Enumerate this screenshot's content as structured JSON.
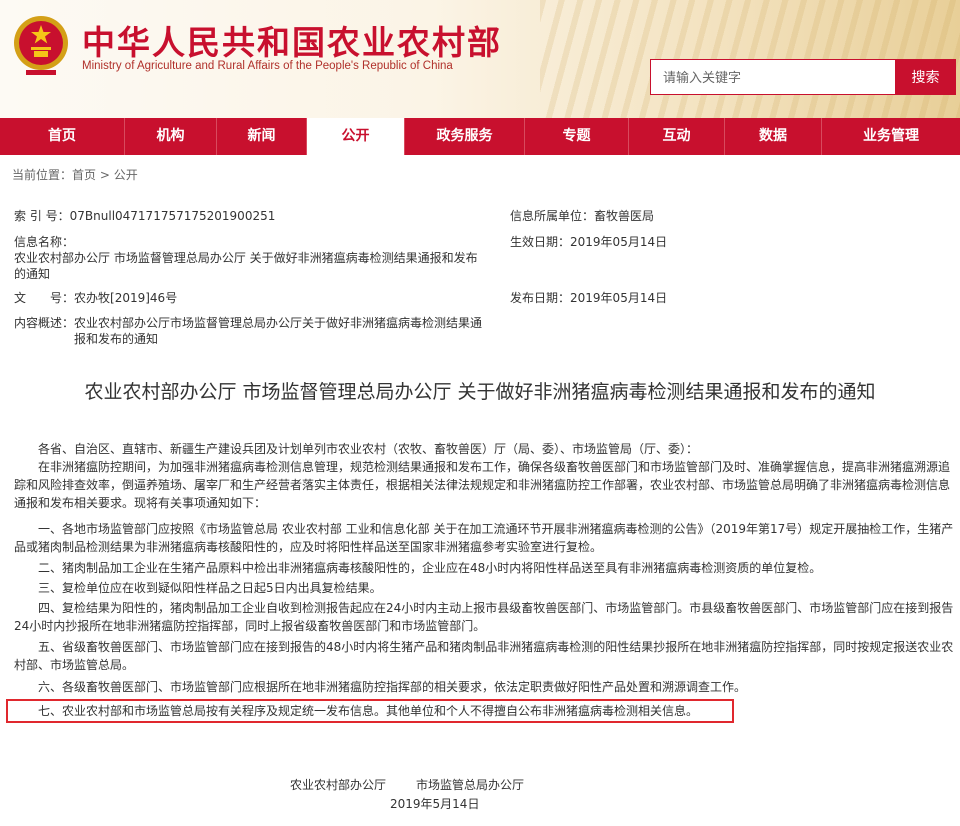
{
  "header": {
    "title": "中华人民共和国农业农村部",
    "subtitle": "Ministry of Agriculture and Rural Affairs of the People's Republic of China",
    "search_placeholder": "请输入关键字",
    "search_button": "搜索",
    "brand_color": "#c8102e"
  },
  "nav": {
    "items": [
      {
        "label": "首页"
      },
      {
        "label": "机构"
      },
      {
        "label": "新闻"
      },
      {
        "label": "公开",
        "active": true
      },
      {
        "label": "政务服务"
      },
      {
        "label": "专题"
      },
      {
        "label": "互动"
      },
      {
        "label": "数据"
      },
      {
        "label": "业务管理"
      }
    ]
  },
  "breadcrumb": {
    "prefix": "当前位置：",
    "home": "首页",
    "sep": " > ",
    "current": "公开"
  },
  "meta": {
    "index_label": "索 引 号：",
    "index_value": "07Bnull047171757175201900251",
    "unit_label": "信息所属单位：",
    "unit_value": "畜牧兽医局",
    "name_label": "信息名称：",
    "name_value": "农业农村部办公厅 市场监督管理总局办公厅 关于做好非洲猪瘟病毒检测结果通报和发布的通知",
    "effective_label": "生效日期：",
    "effective_value": "2019年05月14日",
    "doc_no_label": "文　　号：",
    "doc_no_value": "农办牧[2019]46号",
    "publish_label": "发布日期：",
    "publish_value": "2019年05月14日",
    "summary_label": "内容概述：",
    "summary_value": "农业农村部办公厅市场监督管理总局办公厅关于做好非洲猪瘟病毒检测结果通报和发布的通知"
  },
  "document": {
    "title": "农业农村部办公厅 市场监督管理总局办公厅 关于做好非洲猪瘟病毒检测结果通报和发布的通知",
    "salutation": "各省、自治区、直辖市、新疆生产建设兵团及计划单列市农业农村（农牧、畜牧兽医）厅（局、委）、市场监管局（厅、委）：",
    "intro": "在非洲猪瘟防控期间，为加强非洲猪瘟病毒检测信息管理，规范检测结果通报和发布工作，确保各级畜牧兽医部门和市场监管部门及时、准确掌握信息，提高非洲猪瘟溯源追踪和风险排查效率，倒逼养殖场、屠宰厂和生产经营者落实主体责任，根据相关法律法规规定和非洲猪瘟防控工作部署，农业农村部、市场监管总局明确了非洲猪瘟病毒检测信息通报和发布相关要求。现将有关事项通知如下：",
    "items": [
      "一、各地市场监管部门应按照《市场监管总局 农业农村部 工业和信息化部 关于在加工流通环节开展非洲猪瘟病毒检测的公告》（2019年第17号）规定开展抽检工作，生猪产品或猪肉制品检测结果为非洲猪瘟病毒核酸阳性的，应及时将阳性样品送至国家非洲猪瘟参考实验室进行复检。",
      "二、猪肉制品加工企业在生猪产品原料中检出非洲猪瘟病毒核酸阳性的，企业应在48小时内将阳性样品送至具有非洲猪瘟病毒检测资质的单位复检。",
      "三、复检单位应在收到疑似阳性样品之日起5日内出具复检结果。",
      "四、复检结果为阳性的，猪肉制品加工企业自收到检测报告起应在24小时内主动上报市县级畜牧兽医部门、市场监管部门。市县级畜牧兽医部门、市场监管部门应在接到报告24小时内抄报所在地非洲猪瘟防控指挥部，同时上报省级畜牧兽医部门和市场监管部门。",
      "五、省级畜牧兽医部门、市场监管部门应在接到报告的48小时内将生猪产品和猪肉制品非洲猪瘟病毒检测的阳性结果抄报所在地非洲猪瘟防控指挥部，同时按规定报送农业农村部、市场监管总局。",
      "六、各级畜牧兽医部门、市场监管部门应根据所在地非洲猪瘟防控指挥部的相关要求，依法定职责做好阳性产品处置和溯源调查工作。",
      "七、农业农村部和市场监管总局按有关程序及规定统一发布信息。其他单位和个人不得擅自公布非洲猪瘟病毒检测相关信息。"
    ],
    "signer_1": "农业农村部办公厅",
    "signer_2": "市场监管总局办公厅",
    "date": "2019年5月14日"
  }
}
